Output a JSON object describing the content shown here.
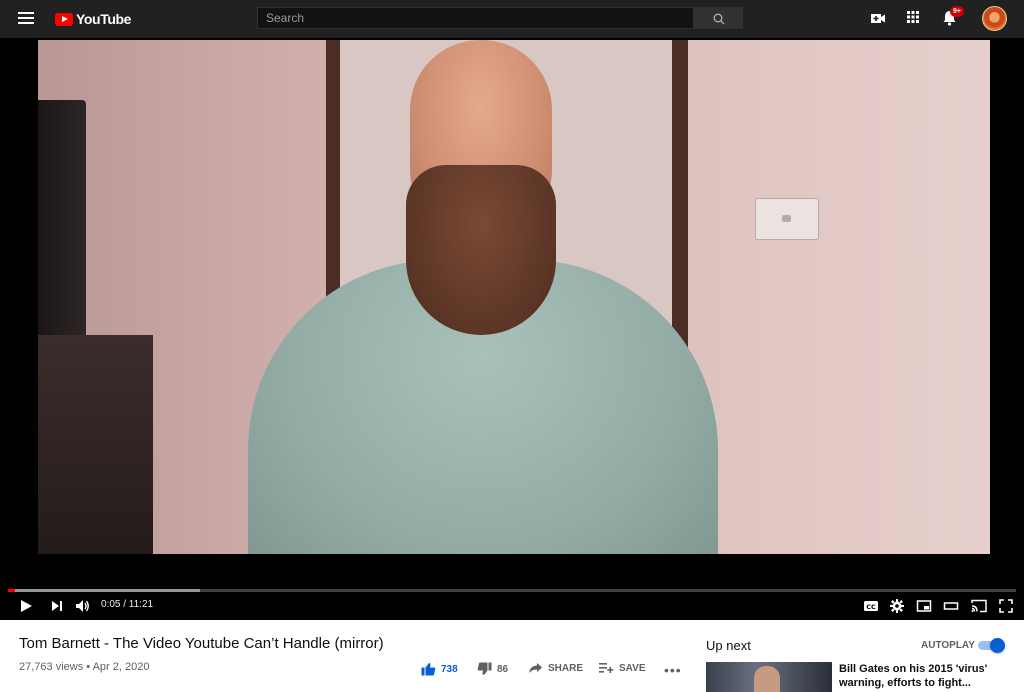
{
  "header": {
    "logo_text": "YouTube",
    "search_placeholder": "Search",
    "notification_count": "9+",
    "icons": [
      "menu-icon",
      "search-icon",
      "create-video-icon",
      "apps-icon",
      "bell-icon"
    ]
  },
  "player": {
    "time_display": "0:05 / 11:21",
    "progress": {
      "played_fraction": 0.007,
      "buffered_fraction": 0.19
    },
    "controls": [
      "play-icon",
      "next-icon",
      "volume-icon",
      "captions-icon",
      "settings-icon",
      "miniplayer-icon",
      "theater-icon",
      "cast-icon",
      "fullscreen-icon"
    ],
    "accent_color": "#ff0000"
  },
  "video": {
    "title": "Tom Barnett - The Video Youtube Can’t Handle (mirror)",
    "meta": "27,763 views • Apr 2, 2020",
    "likes": "738",
    "dislikes": "86",
    "share_label": "SHARE",
    "save_label": "SAVE",
    "more_label": "•••"
  },
  "sidebar": {
    "up_next_label": "Up next",
    "autoplay_label": "AUTOPLAY",
    "autoplay_on": true,
    "recommendations": [
      {
        "title": "Bill Gates on his 2015 'virus' warning, efforts to fight..."
      }
    ]
  }
}
